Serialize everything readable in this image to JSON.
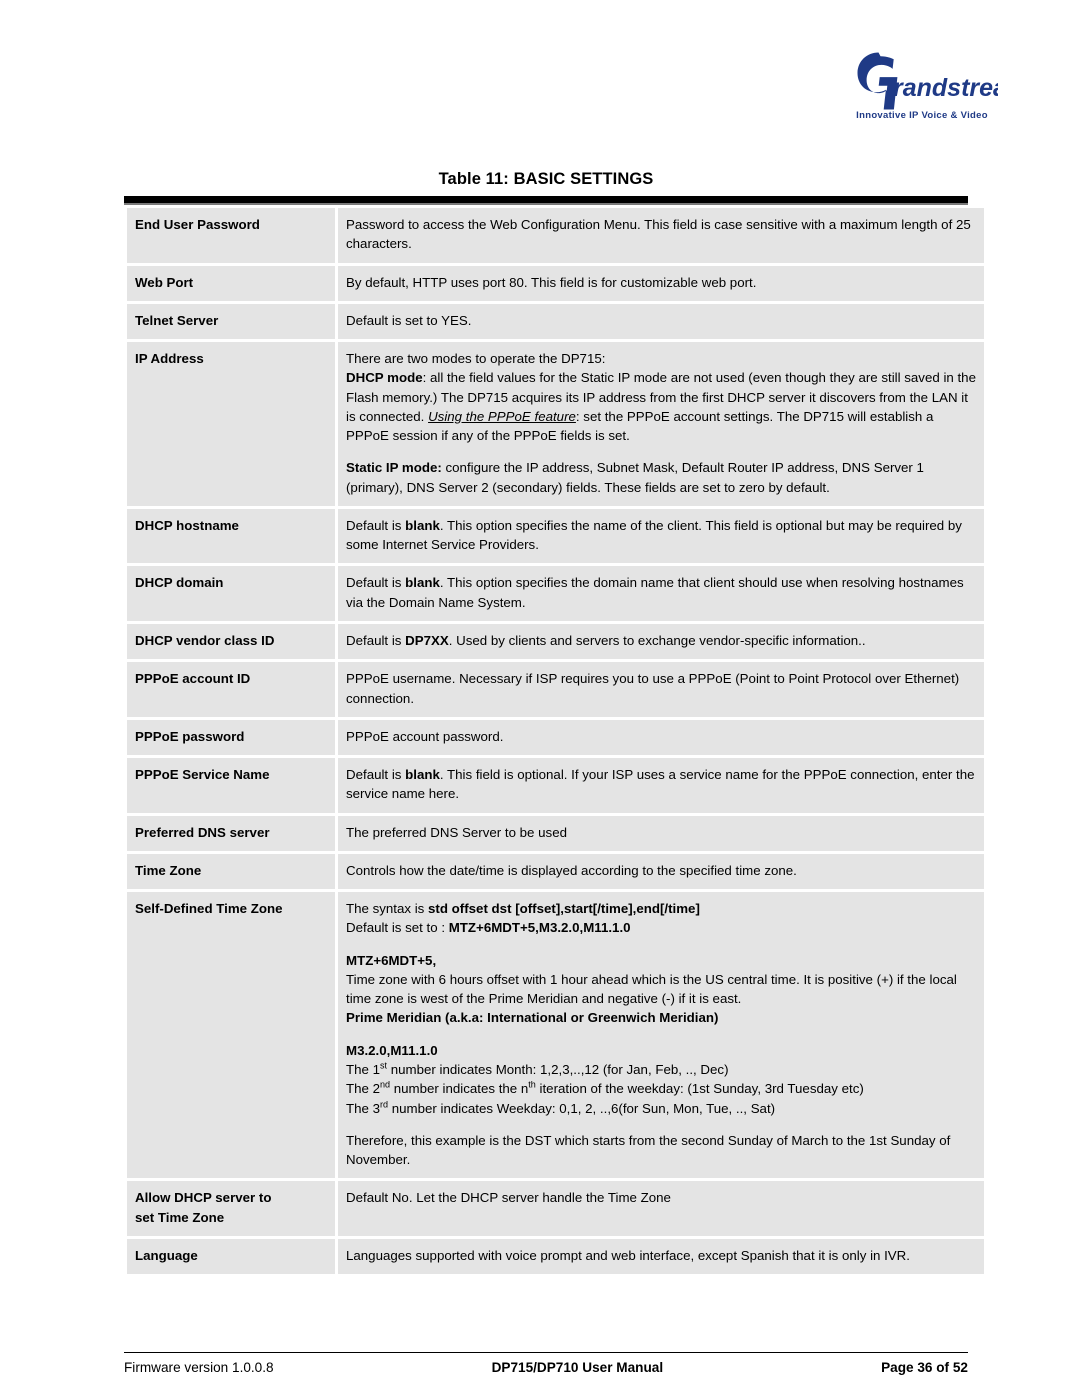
{
  "logo": {
    "brand": "randstream",
    "mark_letter": "G",
    "tagline": "Innovative IP Voice & Video",
    "color": "#1f3a86"
  },
  "table": {
    "title": "Table 11: BASIC SETTINGS",
    "rows": [
      {
        "key": "End User Password",
        "text": "Password to access the Web Configuration Menu. This field is case sensitive with a maximum length of 25 characters."
      },
      {
        "key": "Web Port",
        "text": "By default, HTTP uses port 80.  This field is for customizable web port."
      },
      {
        "key": "Telnet Server",
        "text": "Default is set to YES."
      },
      {
        "key": "IP Address",
        "line1": "There are two modes to operate the DP715:",
        "dhcp_label": "DHCP mode",
        "dhcp_text_a": ": all the field values for the Static IP mode are not used (even though they are still saved in the Flash memory.) The DP715 acquires its IP address from the first DHCP server it discovers from the LAN it is connected.  ",
        "dhcp_emph": "Using the PPPoE feature",
        "dhcp_text_b": ": set the PPPoE account settings. The DP715 will establish a PPPoE session if any of the PPPoE fields is set.",
        "static_label": "Static IP mode:",
        "static_text": " configure the IP address, Subnet Mask, Default Router IP address, DNS Server 1 (primary), DNS Server 2 (secondary) fields. These fields are set to zero by default."
      },
      {
        "key": "DHCP hostname",
        "pre": "Default is ",
        "bold": "blank",
        "post": ". This option specifies the name of the client. This field is optional but may be required by some Internet Service Providers."
      },
      {
        "key": "DHCP domain",
        "pre": "Default is ",
        "bold": "blank",
        "post": ". This option specifies the domain name that client should use when resolving hostnames via the Domain Name System."
      },
      {
        "key": "DHCP vendor class ID",
        "pre": "Default is ",
        "bold": "DP7XX",
        "post": ". Used by clients and servers to exchange vendor-specific information.."
      },
      {
        "key": "PPPoE account ID",
        "text": "PPPoE username. Necessary if ISP requires you to use a PPPoE (Point to Point Protocol over Ethernet) connection."
      },
      {
        "key": "PPPoE password",
        "text": "PPPoE account password."
      },
      {
        "key": "PPPoE Service Name",
        "pre": "Default is ",
        "bold": "blank",
        "post": ". This field is optional. If your ISP uses a service name for the PPPoE connection, enter the service name here."
      },
      {
        "key": "Preferred DNS server",
        "text": "The preferred  DNS Server to be used"
      },
      {
        "key": "Time Zone",
        "text": "Controls how the date/time is displayed according to the specified time zone."
      },
      {
        "key": "Self-Defined Time Zone",
        "syntax_pre": "The syntax is  ",
        "syntax_bold": "std offset dst [offset],start[/time],end[/time]",
        "default_pre": "Default is set to : ",
        "default_bold": "MTZ+6MDT+5,M3.2.0,M11.1.0",
        "mtz_heading": "MTZ+6MDT+5,",
        "mtz_body": "Time zone with 6 hours offset with 1 hour ahead which is the US central time. It is positive (+) if the local time zone is west of the Prime Meridian and negative (-) if it is east.",
        "meridian_heading": "Prime Meridian (a.k.a: International or Greenwich Meridian)",
        "m_heading": "M3.2.0,M11.1.0",
        "n1_a": "The 1",
        "n1_sup": "st",
        "n1_b": " number indicates Month: 1,2,3,..,12 (for Jan, Feb, .., Dec)",
        "n2_a": "The 2",
        "n2_sup": "nd",
        "n2_b": " number indicates the n",
        "n2_sup2": "th",
        "n2_c": " iteration of the weekday: (1st Sunday, 3rd Tuesday etc)",
        "n3_a": "The 3",
        "n3_sup": "rd",
        "n3_b": "  number indicates Weekday: 0,1, 2, ..,6(for Sun, Mon, Tue, .., Sat)",
        "closing": "Therefore, this example is the DST which starts from the second Sunday of March to the 1st Sunday of November."
      },
      {
        "key_line1": "Allow DHCP server to",
        "key_line2": "set Time Zone",
        "text": "Default No. Let the DHCP server handle the Time Zone"
      },
      {
        "key": "Language",
        "text": "Languages supported with voice prompt and web interface, except Spanish that it is only in IVR."
      }
    ]
  },
  "footer": {
    "left": "Firmware version 1.0.0.8",
    "center": "DP715/DP710 User Manual",
    "right": "Page 36 of 52"
  }
}
